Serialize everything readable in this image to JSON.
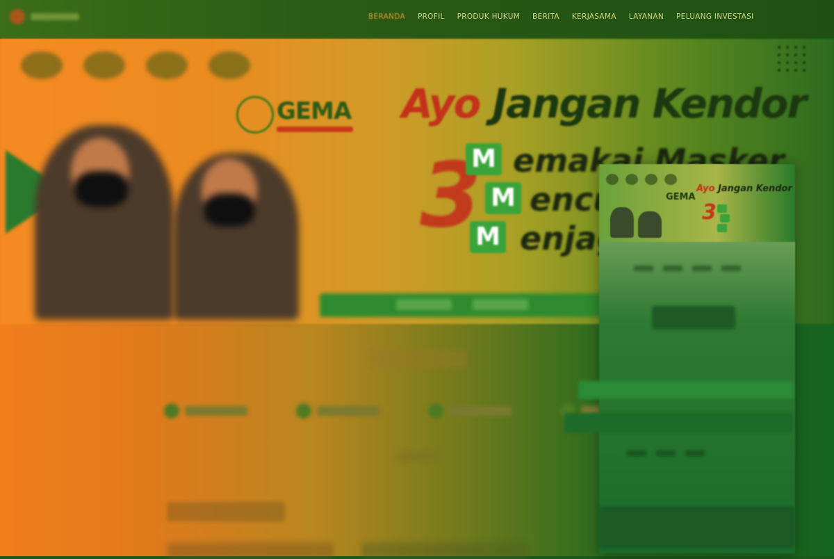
{
  "nav": {
    "items": [
      {
        "label": "BERANDA",
        "active": true
      },
      {
        "label": "PROFIL",
        "active": false
      },
      {
        "label": "PRODUK HUKUM",
        "active": false
      },
      {
        "label": "BERITA",
        "active": false
      },
      {
        "label": "KERJASAMA",
        "active": false
      },
      {
        "label": "LAYANAN",
        "active": false
      },
      {
        "label": "PELUANG INVESTASI",
        "active": false
      }
    ]
  },
  "hero": {
    "gema_logo_text": "GEMA",
    "headline_ayo": "Ayo",
    "headline_rest": "Jangan Kendor",
    "big_number": "3",
    "m_letter": "M",
    "lines": [
      "emakai Masker",
      "encu",
      "enjag"
    ]
  },
  "mini_preview": {
    "gema_logo_text": "GEMA",
    "headline_ayo": "Ayo",
    "headline_rest": "Jangan Kendor",
    "big_number": "3"
  },
  "colors": {
    "orange": "#f07f1b",
    "green": "#16621f",
    "accent_red": "#c3321a",
    "m_green": "#3aa43a"
  }
}
